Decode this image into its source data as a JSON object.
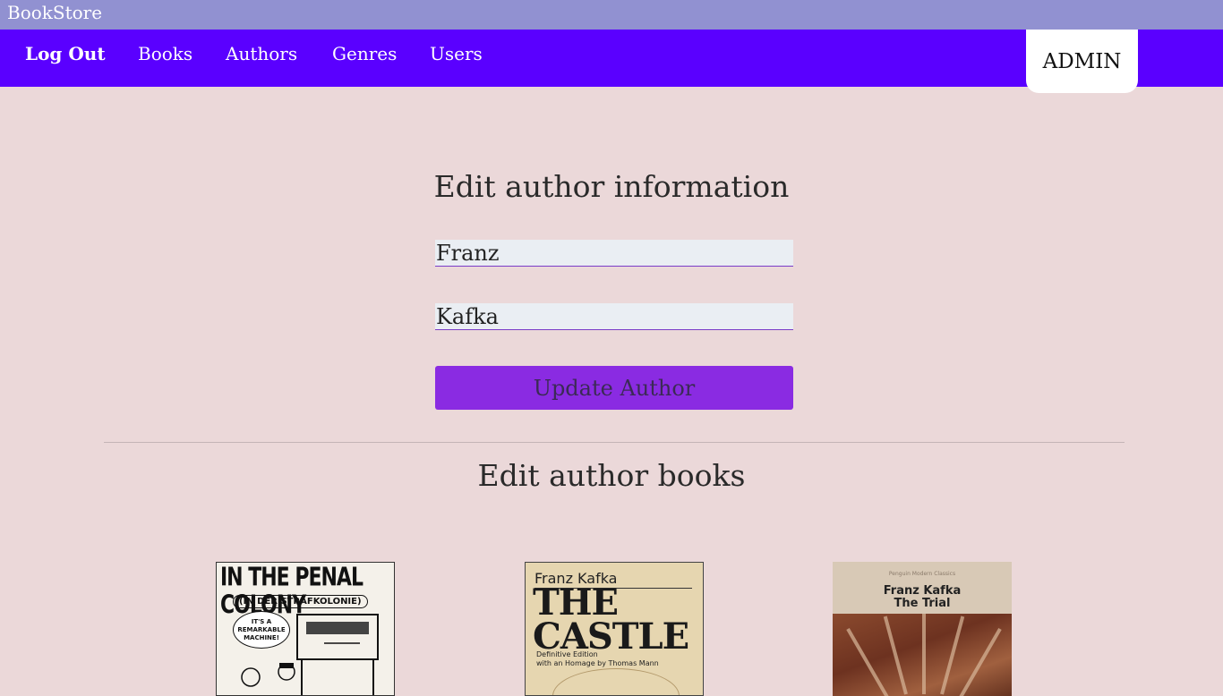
{
  "app": {
    "title": "BookStore"
  },
  "nav": {
    "logout_label": "Log Out",
    "links": [
      "Books",
      "Authors",
      "Genres",
      "Users"
    ],
    "role_badge": "ADMIN"
  },
  "author_form": {
    "heading": "Edit author information",
    "first_name": "Franz",
    "last_name": "Kafka",
    "submit_label": "Update Author"
  },
  "books_section": {
    "heading": "Edit author books",
    "books": [
      {
        "title_lines": [
          "IN THE PENAL COLONY"
        ],
        "subtitle": "(IN DER STRAFKOLONIE)",
        "bubble": "IT'S A REMARKABLE MACHINE!"
      },
      {
        "author": "Franz Kafka",
        "title_lines": [
          "THE",
          "CASTLE"
        ],
        "note_lines": [
          "Definitive Edition",
          "with an Homage by Thomas Mann"
        ]
      },
      {
        "series": "Penguin Modern Classics",
        "author": "Franz Kafka",
        "title": "The Trial"
      }
    ]
  },
  "colors": {
    "background": "#ebd8d9",
    "titlebar": "#9191d1",
    "navbar": "#5a00ff",
    "button": "#8a2be2",
    "input_bg": "#eaeef3"
  }
}
